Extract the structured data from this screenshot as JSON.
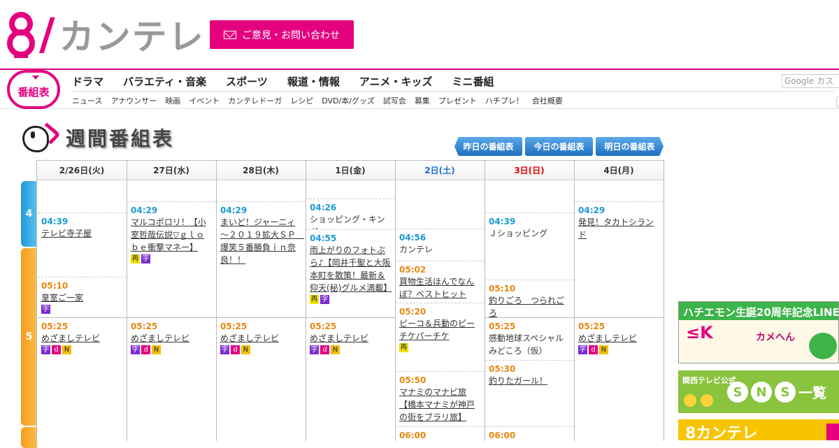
{
  "header": {
    "logo_mark": "8",
    "logo_slash": "/",
    "logo_text": "カンテレ",
    "feedback_label": "ご意見・お問い合わせ"
  },
  "nav": {
    "bangumi_label": "番組表",
    "main": [
      "ドラマ",
      "バラエティ・音楽",
      "スポーツ",
      "報道・情報",
      "アニメ・キッズ",
      "ミニ番組"
    ],
    "sub": [
      "ニュース",
      "アナウンサー",
      "映画",
      "イベント",
      "カンテレドーガ",
      "レシピ",
      "DVD/本/グッズ",
      "試写会",
      "募集",
      "プレゼント",
      "ハチプレ！",
      "会社概要"
    ],
    "search_placeholder": "Google カス"
  },
  "page_title": "週間番組表",
  "day_buttons": [
    "昨日の番組表",
    "今日の番組表",
    "明日の番組表"
  ],
  "hours": [
    "4",
    "5"
  ],
  "days": [
    {
      "label": "2/26日(火)",
      "kind": "normal"
    },
    {
      "label": "27日(水)",
      "kind": "normal"
    },
    {
      "label": "28日(木)",
      "kind": "normal"
    },
    {
      "label": "1日(金)",
      "kind": "normal"
    },
    {
      "label": "2日(土)",
      "kind": "sat"
    },
    {
      "label": "3日(日)",
      "kind": "sun"
    },
    {
      "label": "4日(月)",
      "kind": "normal"
    }
  ],
  "programs": {
    "d0": [
      {
        "time": "04:39",
        "title": "テレビ寺子屋",
        "badges": []
      },
      {
        "time": "05:10",
        "title": "皇室ご一家",
        "badges": [
          "字"
        ]
      },
      {
        "time": "05:25",
        "title": "めざましテレビ",
        "badges": [
          "字",
          "d",
          "N"
        ]
      }
    ],
    "d1": [
      {
        "time": "04:29",
        "title": "マルコポロリ！【小室哲哉伝説▽ｇｌｏｂｅ衝撃マネー】",
        "badges": [
          "再",
          "字"
        ]
      },
      {
        "time": "05:25",
        "title": "めざましテレビ",
        "badges": [
          "字",
          "d",
          "N"
        ]
      }
    ],
    "d2": [
      {
        "time": "04:29",
        "title": "まいど！ジャーニィ～２０１９拡大ＳＰ　爆笑５番勝負ｉｎ奈良！！",
        "badges": []
      },
      {
        "time": "05:25",
        "title": "めざましテレビ",
        "badges": [
          "字",
          "d",
          "N"
        ]
      }
    ],
    "d3": [
      {
        "time": "04:26",
        "title": "ショッピング・キング",
        "badges": []
      },
      {
        "time": "04:55",
        "title": "雨上がりのフォトぶら♪【岡井千聖と大阪本町を散策！最新＆仰天(秘)グルメ満載】",
        "badges": [
          "再",
          "字"
        ]
      },
      {
        "time": "05:25",
        "title": "めざましテレビ",
        "badges": [
          "字",
          "d",
          "N"
        ]
      }
    ],
    "d4": [
      {
        "time": "04:56",
        "title": "カンテレ",
        "badges": []
      },
      {
        "time": "05:02",
        "title": "買物生活ほんでなんぼ？ベストヒット",
        "badges": []
      },
      {
        "time": "05:20",
        "title": "ピーコ＆兵動のピーチケパーチケ",
        "badges": [
          "再"
        ]
      },
      {
        "time": "05:50",
        "title": "マナミのマナビ旅【橋本マナミが神戸の街をブラリ旅】",
        "badges": []
      },
      {
        "time": "06:00",
        "title": "",
        "badges": []
      }
    ],
    "d5": [
      {
        "time": "04:39",
        "title": "Ｊショッピング",
        "badges": []
      },
      {
        "time": "05:10",
        "title": "釣りごろ　つられごろ",
        "badges": []
      },
      {
        "time": "05:25",
        "title": "感動地球スペシャルみどころ（仮）",
        "badges": []
      },
      {
        "time": "05:30",
        "title": "釣りたガール！",
        "badges": []
      },
      {
        "time": "06:00",
        "title": "",
        "badges": []
      }
    ],
    "d6": [
      {
        "time": "04:29",
        "title": "発見！タカトシランド",
        "badges": []
      },
      {
        "time": "05:25",
        "title": "めざましテレビ",
        "badges": [
          "字",
          "d",
          "N"
        ]
      }
    ]
  },
  "ads": {
    "ad1_title": "ハチエモン生誕20周年記念LINE",
    "ad1_k": "≤K",
    "ad1_kame": "カメへん",
    "ad2_small": "関西テレビ公式",
    "ad2_letters": [
      "S",
      "N",
      "S"
    ],
    "ad2_big": "一覧",
    "ad3_text": "8カンテレ"
  }
}
